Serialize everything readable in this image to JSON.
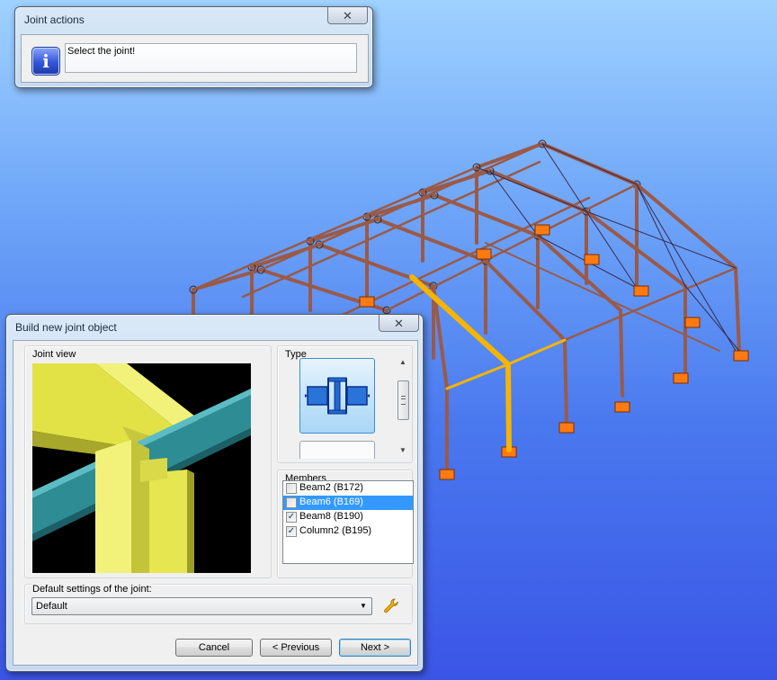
{
  "joint_actions": {
    "title": "Joint actions",
    "close_symbol": "✕",
    "message": "Select the joint!",
    "icon": "info-icon"
  },
  "build_joint": {
    "title": "Build new joint object",
    "close_symbol": "✕",
    "joint_view_label": "Joint view",
    "type_label": "Type",
    "members_label": "Members",
    "members": [
      {
        "label": "Beam2 (B172)",
        "checked": false,
        "selected": false
      },
      {
        "label": "Beam6 (B169)",
        "checked": false,
        "selected": true
      },
      {
        "label": "Beam8 (B190)",
        "checked": true,
        "selected": false
      },
      {
        "label": "Column2 (B195)",
        "checked": true,
        "selected": false
      }
    ],
    "default_settings_label": "Default settings of the joint:",
    "default_settings_value": "Default",
    "buttons": {
      "cancel": "Cancel",
      "previous": "< Previous",
      "next": "Next >"
    }
  },
  "colors": {
    "frame": "#9a5a48",
    "support": "#ff7a10",
    "highlight": "#f5b400",
    "joint_view_beam": "#e8e84a",
    "joint_view_column": "#2c8a92"
  }
}
